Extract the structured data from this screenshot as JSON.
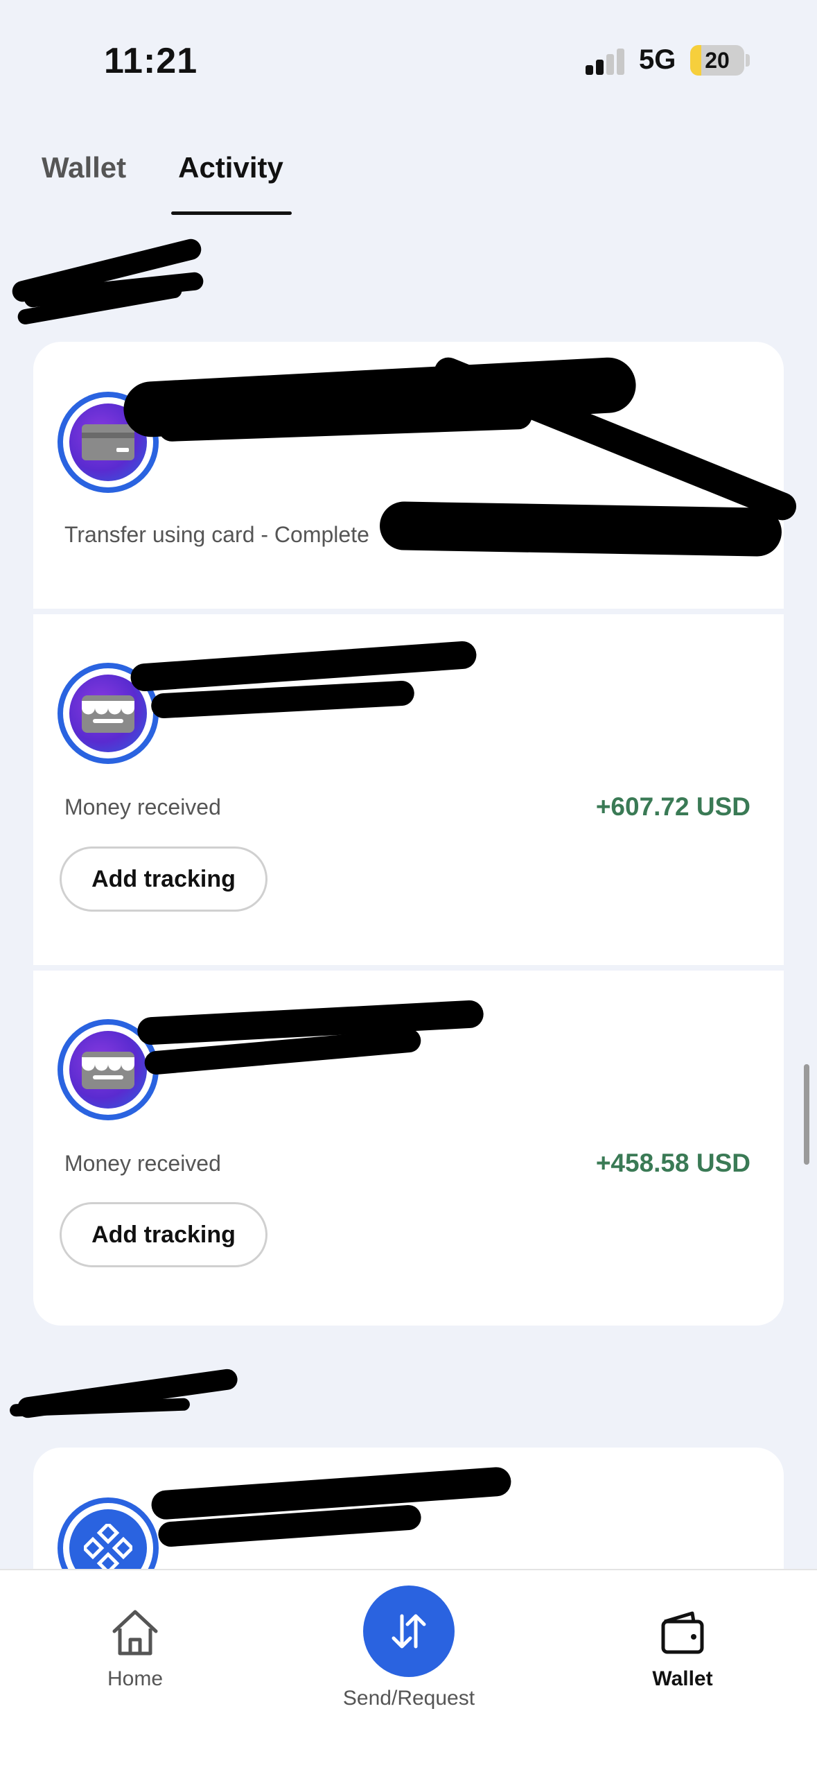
{
  "status_bar": {
    "time": "11:21",
    "network": "5G",
    "battery": "20",
    "battery_level": 0.2
  },
  "tabs": [
    {
      "label": "Wallet",
      "active": false
    },
    {
      "label": "Activity",
      "active": true
    }
  ],
  "transactions": [
    {
      "icon": "credit-card-icon",
      "description": "Transfer using card - Complete",
      "amount": ""
    },
    {
      "icon": "store-icon",
      "description": "Money received",
      "amount": "+607.72 USD",
      "action_label": "Add tracking"
    },
    {
      "icon": "store-icon",
      "description": "Money received",
      "amount": "+458.58 USD",
      "action_label": "Add tracking"
    },
    {
      "icon": "app-grid-icon"
    }
  ],
  "bottom_nav": {
    "home_label": "Home",
    "send_label": "Send/Request",
    "wallet_label": "Wallet",
    "active": "Wallet"
  },
  "colors": {
    "background": "#eff2f9",
    "accent": "#2a63e0",
    "positive_amount": "#3a7a55",
    "card": "#ffffff"
  }
}
